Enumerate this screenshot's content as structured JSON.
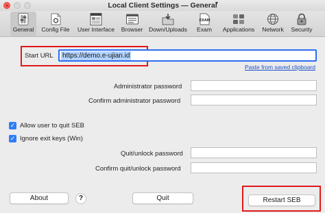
{
  "window": {
    "title": "Local Client Settings — General",
    "close_glyph": "×"
  },
  "toolbar": {
    "items": [
      {
        "label": "General",
        "icon": "general-icon",
        "active": true
      },
      {
        "label": "Config File",
        "icon": "config-file-icon"
      },
      {
        "label": "User Interface",
        "icon": "user-interface-icon"
      },
      {
        "label": "Browser",
        "icon": "browser-icon"
      },
      {
        "label": "Down/Uploads",
        "icon": "downloads-icon"
      },
      {
        "label": "Exam",
        "icon": "exam-icon"
      },
      {
        "label": "Applications",
        "icon": "applications-icon"
      },
      {
        "label": "Network",
        "icon": "network-icon"
      },
      {
        "label": "Security",
        "icon": "security-icon"
      }
    ],
    "exam_icon_text": "EXAM"
  },
  "general": {
    "start_url_label": "Start URL",
    "start_url_value": "https://demo.e-ujian.id",
    "paste_link": "Paste from saved clipboard",
    "admin_password_label": "Administrator password",
    "confirm_admin_password_label": "Confirm administrator password",
    "allow_quit_label": "Allow user to quit SEB",
    "allow_quit_checked": true,
    "ignore_exit_keys_label": "Ignore exit keys (Win)",
    "ignore_exit_keys_checked": true,
    "quit_password_label": "Quit/unlock password",
    "confirm_quit_password_label": "Confirm quit/unlock password",
    "check_glyph": "✓"
  },
  "buttons": {
    "about": "About",
    "help": "?",
    "quit": "Quit",
    "restart": "Restart SEB"
  },
  "colors": {
    "highlight_red": "#e01818",
    "focus_blue": "#2a6df4",
    "link_blue": "#1a50c8",
    "checkbox_blue": "#2f7df6"
  }
}
